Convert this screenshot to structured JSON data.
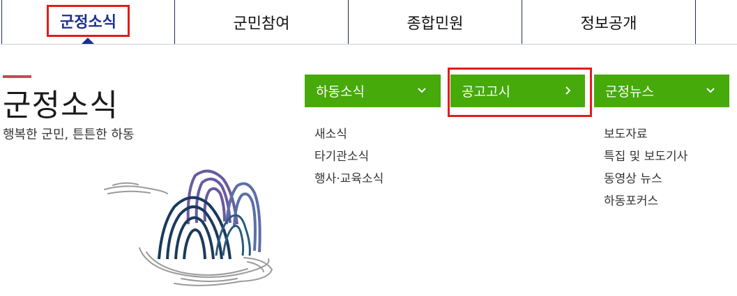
{
  "topnav": {
    "tabs": [
      {
        "label": "군정소식",
        "active": true
      },
      {
        "label": "군민참여",
        "active": false
      },
      {
        "label": "종합민원",
        "active": false
      },
      {
        "label": "정보공개",
        "active": false
      }
    ]
  },
  "section": {
    "title": "군정소식",
    "subtitle": "행복한 군민, 튼튼한 하동"
  },
  "menus": [
    {
      "label": "하동소식",
      "icon": "chevron-down-icon",
      "items": [
        "새소식",
        "타기관소식",
        "행사·교육소식"
      ]
    },
    {
      "label": "공고고시",
      "icon": "chevron-right-icon",
      "items": []
    },
    {
      "label": "군정뉴스",
      "icon": "chevron-down-icon",
      "items": [
        "보도자료",
        "특집 및 보도기사",
        "동영상 뉴스",
        "하동포커스"
      ]
    }
  ],
  "colors": {
    "menu_green": "#46aa0a",
    "active_blue": "#1d2f8c",
    "highlight_red": "#e31b1b",
    "accent_bar": "#c64a55"
  }
}
